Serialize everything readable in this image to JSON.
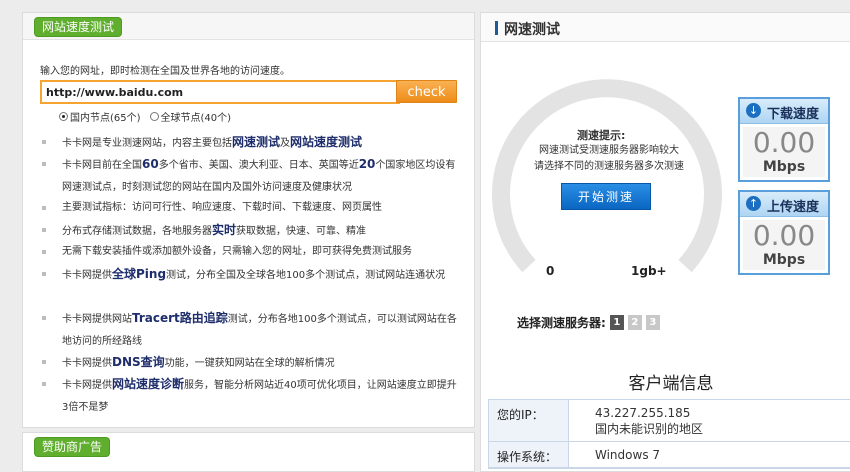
{
  "left": {
    "tab_label": "网站速度测试",
    "intro": "输入您的网址，即时检测在全国及世界各地的访问速度。",
    "url_value": "http://www.baidu.com",
    "check_label": "check",
    "radio_domestic": "国内节点(65个)",
    "radio_global": "全球节点(40个)",
    "features": [
      {
        "pre": "卡卡网是专业测速网站，内容主要包括",
        "b1": "网速测试",
        "mid": "及",
        "b2": "网站速度测试",
        "post": ""
      },
      {
        "pre": "卡卡网目前在全国",
        "b1": "60",
        "mid": "多个省市、美国、澳大利亚、日本、英国等近",
        "b2": "20",
        "post": "个国家地区均设有网速测试点，时刻测试您的网站在国内及国外访问速度及健康状况"
      },
      {
        "pre": "主要测试指标：访问可行性、响应速度、下载时间、下载速度、网页属性",
        "b1": "",
        "mid": "",
        "b2": "",
        "post": ""
      },
      {
        "pre": "分布式存储测试数据，各地服务器",
        "b1": "实时",
        "mid": "获取数据，快速、可靠、精准",
        "b2": "",
        "post": ""
      },
      {
        "pre": "无需下载安装插件或添加额外设备，只需输入您的网址，即可获得免费测试服务",
        "b1": "",
        "mid": "",
        "b2": "",
        "post": ""
      },
      {
        "pre": "卡卡网提供",
        "b1": "全球Ping",
        "mid": "测试，分布全国及全球各地100多个测试点，测试网站连通状况",
        "b2": "",
        "post": ""
      },
      {
        "pre": "卡卡网提供网站",
        "b1": "Tracert路由追踪",
        "mid": "测试，分布各地100多个测试点，可以测试网站在各地访问的所经路线",
        "b2": "",
        "post": ""
      },
      {
        "pre": "卡卡网提供",
        "b1": "DNS查询",
        "mid": "功能，一键获知网站在全球的解析情况",
        "b2": "",
        "post": ""
      },
      {
        "pre": "卡卡网提供",
        "b1": "网站速度诊断",
        "mid": "服务，智能分析网站近40项可优化项目，让网站速度立即提升3倍不是梦",
        "b2": "",
        "post": ""
      }
    ],
    "sponsor_label": "赞助商广告"
  },
  "right": {
    "title": "网速测试",
    "hint_title": "测速提示:",
    "hint_line1": "网速测试受测速服务器影响较大",
    "hint_line2": "请选择不同的测速服务器多次测速",
    "start_label": "开始测速",
    "gauge_min": "0",
    "gauge_max": "1gb+",
    "download": {
      "title": "下载速度",
      "value": "0.00",
      "unit": "Mbps"
    },
    "upload": {
      "title": "上传速度",
      "value": "0.00",
      "unit": "Mbps"
    },
    "server_label": "选择测速服务器:",
    "servers": [
      "1",
      "2",
      "3"
    ],
    "client_title": "客户端信息",
    "ip_key": "您的IP：",
    "ip_value": "43.227.255.185",
    "ip_location": "国内未能识别的地区",
    "os_key": "操作系统：",
    "os_value": "Windows 7"
  },
  "colors": {
    "green": "#5fae2e",
    "orange": "#f5a431",
    "blue": "#0a66c2"
  }
}
